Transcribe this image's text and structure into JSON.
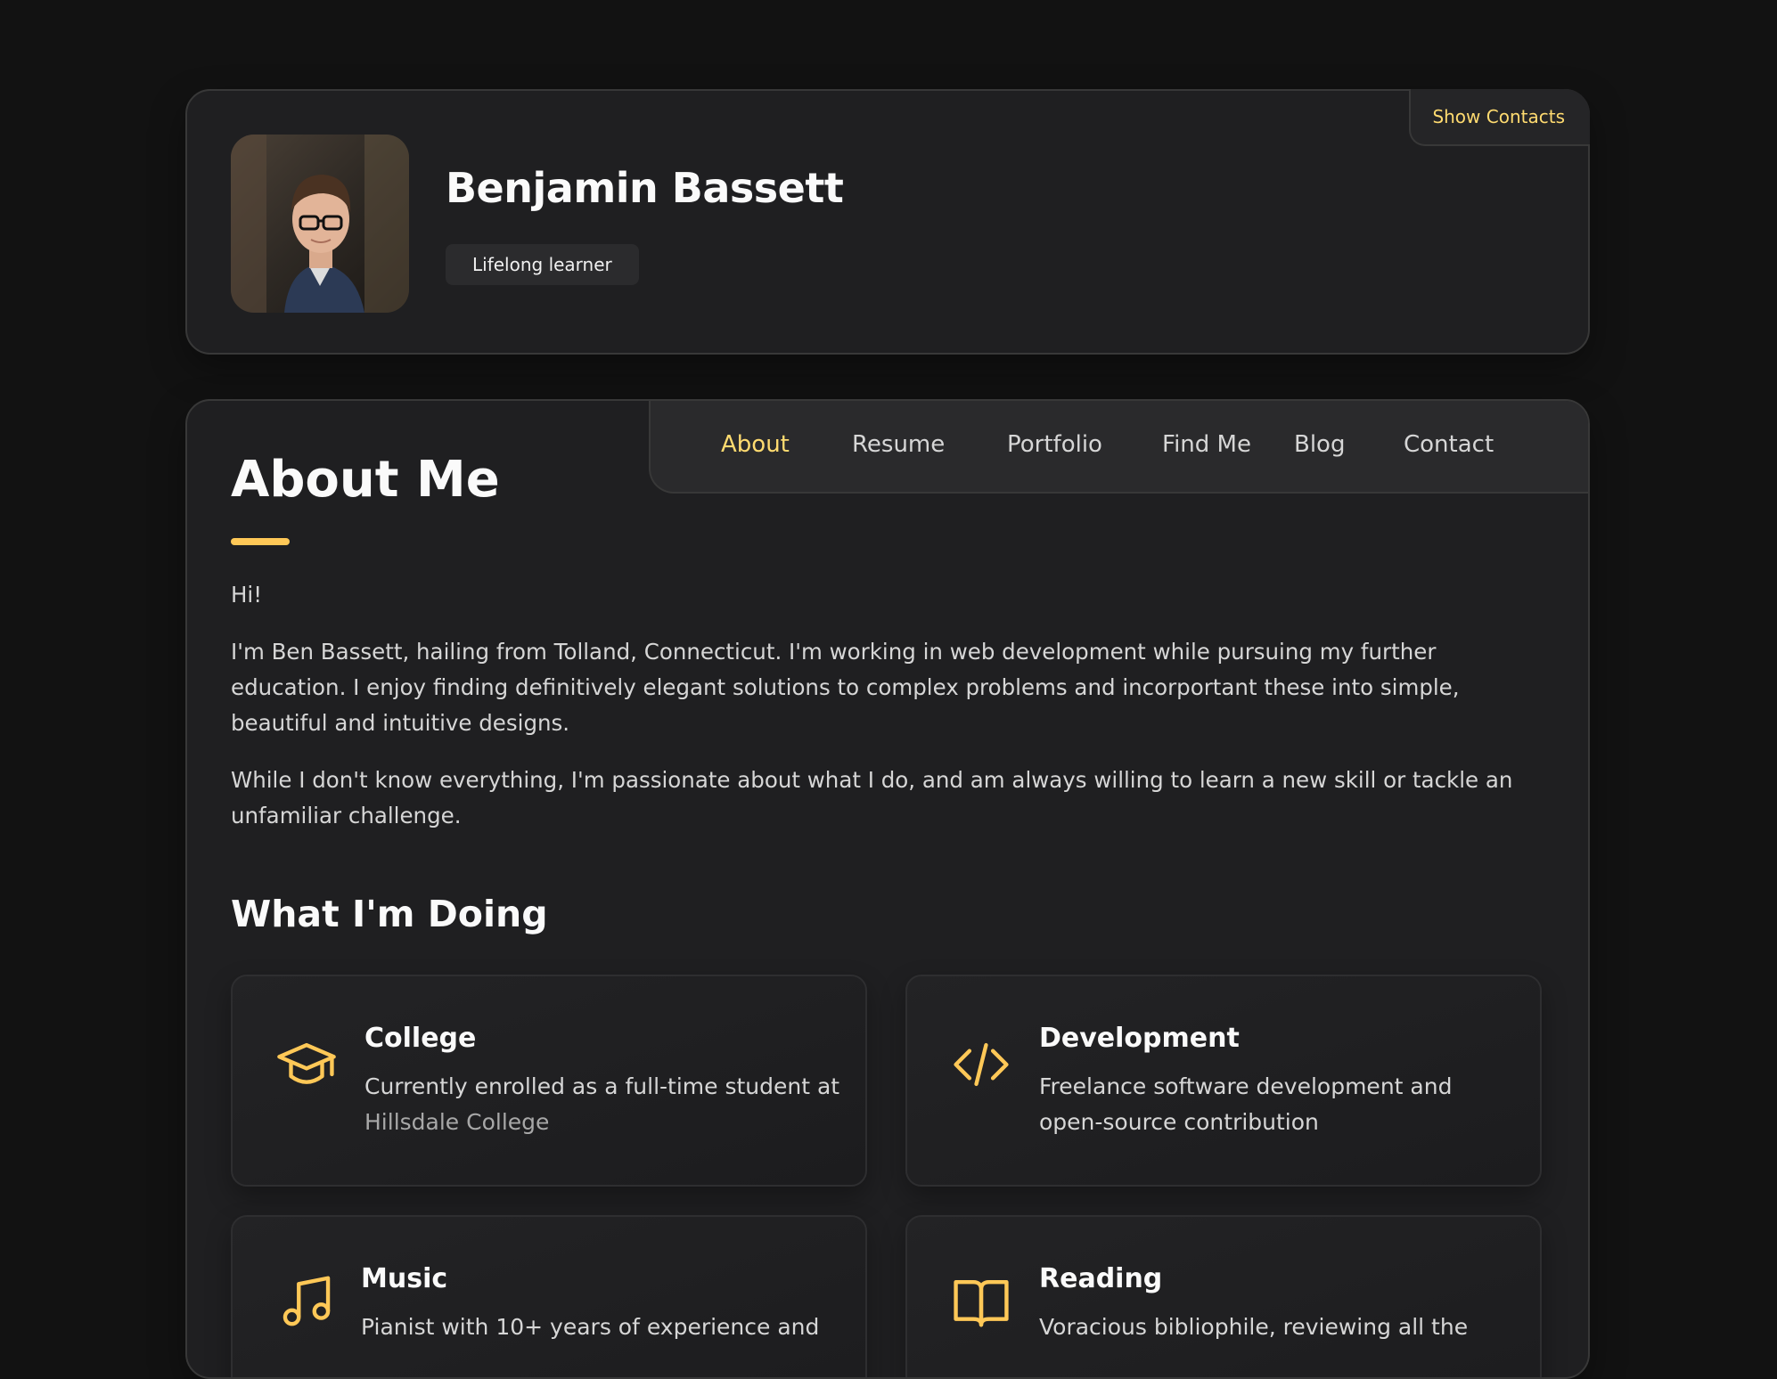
{
  "profile": {
    "name": "Benjamin Bassett",
    "title": "Lifelong learner",
    "show_contacts_label": "Show Contacts"
  },
  "navbar": {
    "items": [
      {
        "label": "About",
        "active": true
      },
      {
        "label": "Resume",
        "active": false
      },
      {
        "label": "Portfolio",
        "active": false
      },
      {
        "label": "Find Me",
        "active": false
      },
      {
        "label": "Blog",
        "active": false
      },
      {
        "label": "Contact",
        "active": false
      }
    ]
  },
  "about": {
    "title": "About Me",
    "paragraphs": [
      "Hi!",
      "I'm Ben Bassett, hailing from Tolland, Connecticut. I'm working in web development while pursuing my further education. I enjoy finding definitively elegant solutions to complex problems and incorportant these into simple, beautiful and intuitive designs.",
      "While I don't know everything, I'm passionate about what I do, and am always willing to learn a new skill or tackle an unfamiliar challenge."
    ]
  },
  "services": {
    "title": "What I'm Doing",
    "items": [
      {
        "title": "College",
        "text": "Currently enrolled as a full-time student at ",
        "link_text": "Hillsdale College",
        "icon": "graduation-cap-icon"
      },
      {
        "title": "Development",
        "text": "Freelance software development and open-source contribution",
        "icon": "code-icon"
      },
      {
        "title": "Music",
        "text": "Pianist with 10+ years of experience and",
        "icon": "music-note-icon"
      },
      {
        "title": "Reading",
        "text": "Voracious bibliophile, reviewing all the",
        "icon": "open-book-icon"
      }
    ]
  },
  "colors": {
    "accent": "#ffdb70",
    "background": "#121212",
    "card": "#1f1f21"
  }
}
